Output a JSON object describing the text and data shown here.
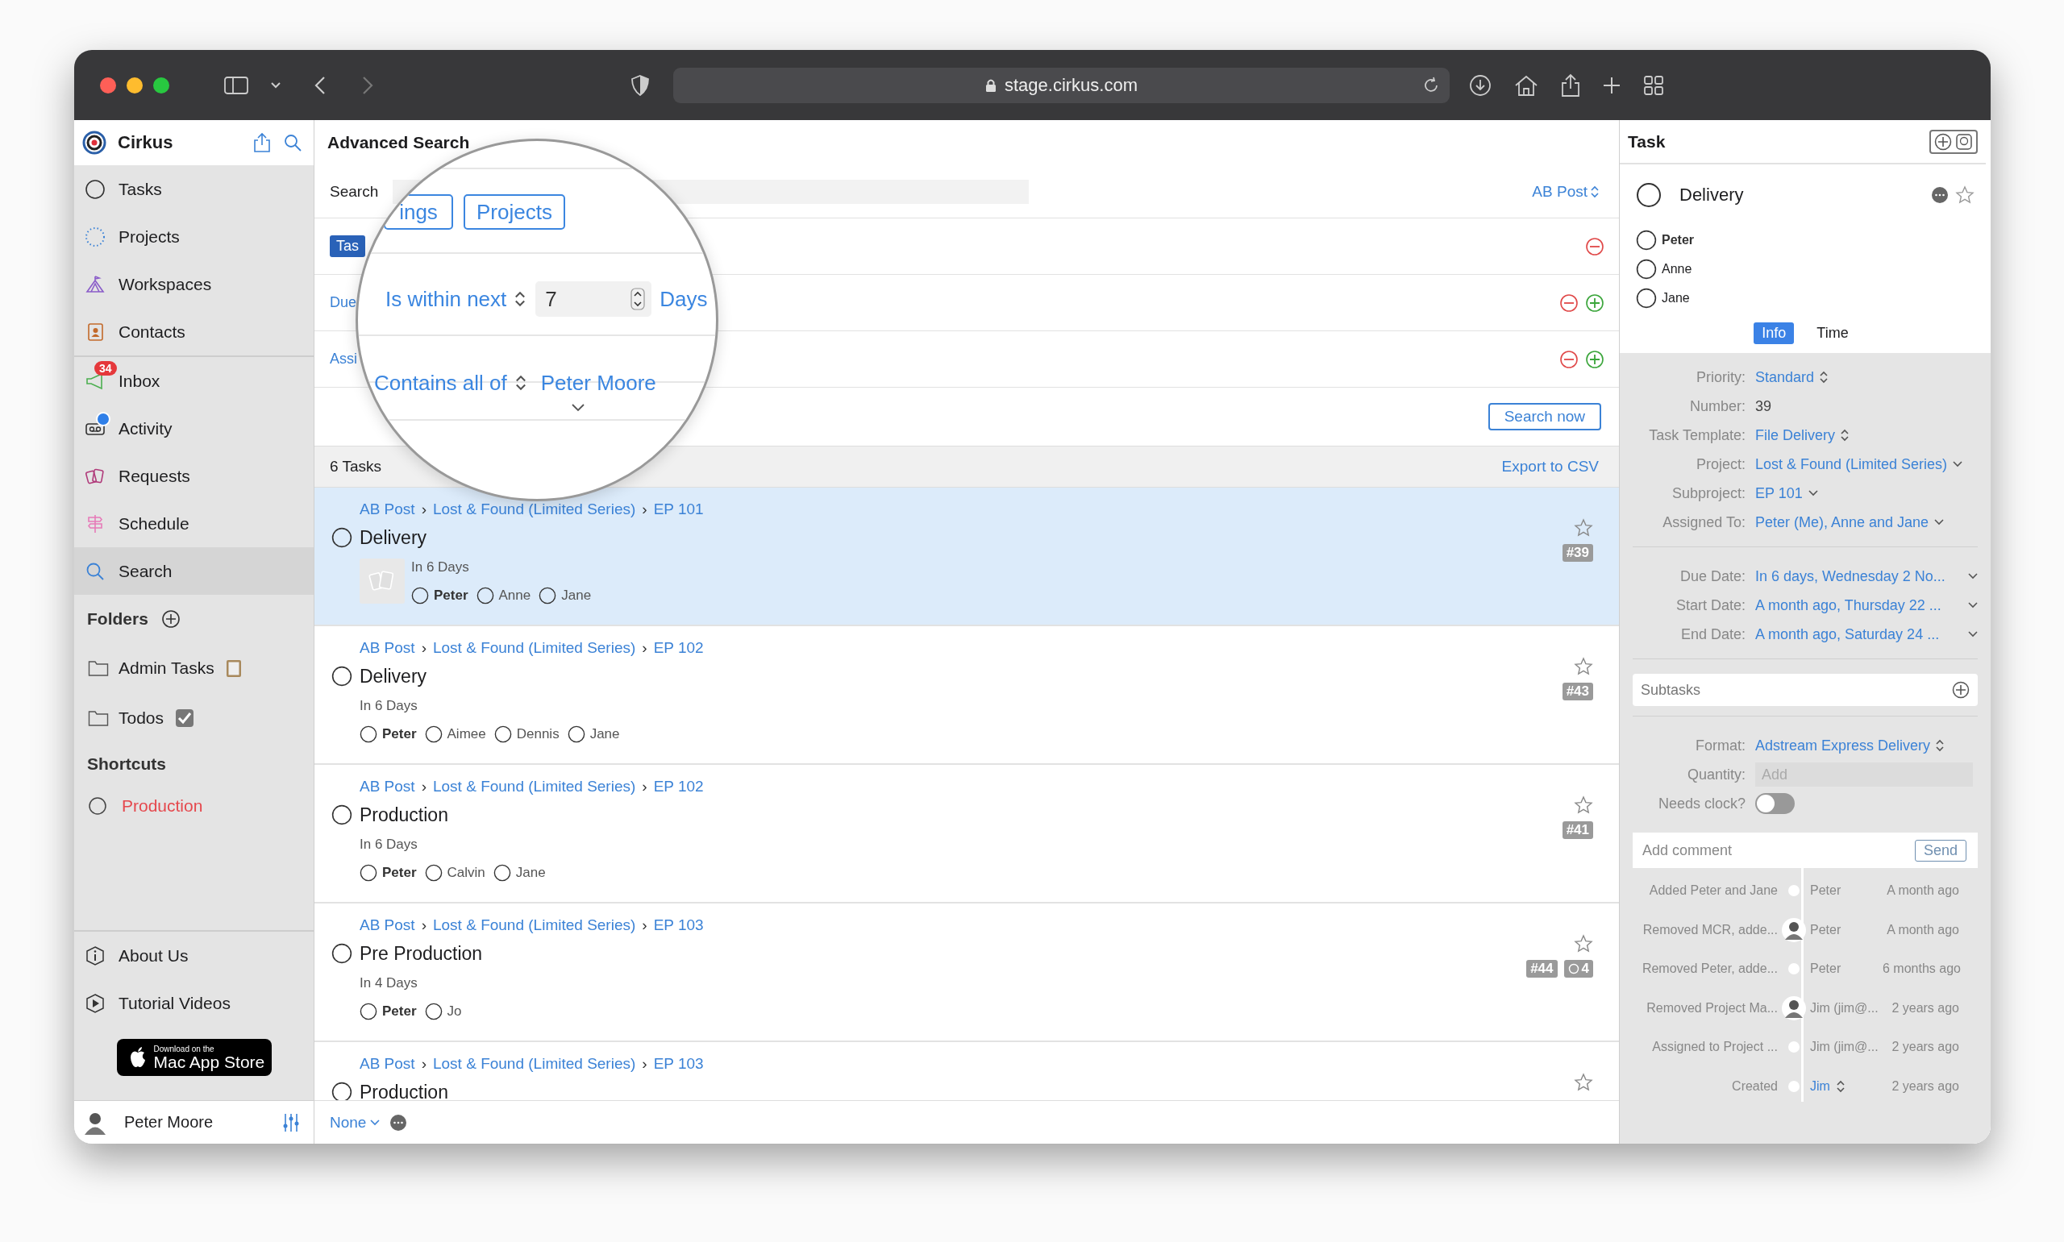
{
  "browser": {
    "url": "stage.cirkus.com"
  },
  "sidebar": {
    "app_name": "Cirkus",
    "nav_top": [
      {
        "label": "Tasks",
        "kind": "tasks",
        "selected": false
      },
      {
        "label": "Projects",
        "kind": "projects",
        "selected": false
      },
      {
        "label": "Workspaces",
        "kind": "workspaces",
        "selected": false
      },
      {
        "label": "Contacts",
        "kind": "contacts",
        "selected": false
      }
    ],
    "nav_bottom": [
      {
        "label": "Inbox",
        "kind": "inbox",
        "selected": false,
        "badge": "34"
      },
      {
        "label": "Activity",
        "kind": "activity",
        "selected": false,
        "unread": true
      },
      {
        "label": "Requests",
        "kind": "requests",
        "selected": false
      },
      {
        "label": "Schedule",
        "kind": "schedule",
        "selected": false
      },
      {
        "label": "Search",
        "kind": "search",
        "selected": true
      }
    ],
    "folders_title": "Folders",
    "folders": [
      {
        "label": "Admin Tasks",
        "kind": "notes"
      },
      {
        "label": "Todos",
        "kind": "checklist"
      }
    ],
    "shortcuts_title": "Shortcuts",
    "shortcuts": [
      {
        "label": "Production"
      }
    ],
    "footer_links": [
      {
        "label": "About Us",
        "kind": "info"
      },
      {
        "label": "Tutorial Videos",
        "kind": "video"
      }
    ],
    "store_badge": {
      "line1": "Download on the",
      "line2": "Mac App Store"
    },
    "user": {
      "name": "Peter Moore"
    }
  },
  "search": {
    "title": "Advanced Search",
    "label": "Search",
    "scope": "AB Post",
    "type_chip": "Tas",
    "criteria": [
      {
        "label": "Due",
        "add": true
      },
      {
        "label": "Assi",
        "add": true
      }
    ],
    "search_button": "Search now",
    "magnifier": {
      "buttons": [
        "ings",
        "Projects"
      ],
      "condition_1": {
        "operator": "Is within next",
        "value": "7",
        "unit": "Days"
      },
      "condition_2": {
        "operator": "Contains all of",
        "value": "Peter Moore"
      }
    }
  },
  "results": {
    "count": "6 Tasks",
    "export": "Export to CSV",
    "separator": "›",
    "tasks": [
      {
        "path": [
          "AB Post",
          "Lost & Found (Limited Series)",
          "EP 101"
        ],
        "title": "Delivery",
        "due": "In 6 Days",
        "thumbnail": true,
        "selected": true,
        "number": "#39",
        "assignees": [
          {
            "name": "Peter",
            "me": true
          },
          {
            "name": "Anne",
            "me": false
          },
          {
            "name": "Jane",
            "me": false
          }
        ]
      },
      {
        "path": [
          "AB Post",
          "Lost & Found (Limited Series)",
          "EP 102"
        ],
        "title": "Delivery",
        "due": "In 6 Days",
        "thumbnail": false,
        "selected": false,
        "number": "#43",
        "assignees": [
          {
            "name": "Peter",
            "me": true
          },
          {
            "name": "Aimee",
            "me": false
          },
          {
            "name": "Dennis",
            "me": false
          },
          {
            "name": "Jane",
            "me": false
          }
        ]
      },
      {
        "path": [
          "AB Post",
          "Lost & Found (Limited Series)",
          "EP 102"
        ],
        "title": "Production",
        "due": "In 6 Days",
        "thumbnail": false,
        "selected": false,
        "number": "#41",
        "assignees": [
          {
            "name": "Peter",
            "me": true
          },
          {
            "name": "Calvin",
            "me": false
          },
          {
            "name": "Jane",
            "me": false
          }
        ]
      },
      {
        "path": [
          "AB Post",
          "Lost & Found (Limited Series)",
          "EP 103"
        ],
        "title": "Pre Production",
        "due": "In 4 Days",
        "thumbnail": false,
        "selected": false,
        "number": "#44",
        "subtasks": "4",
        "assignees": [
          {
            "name": "Peter",
            "me": true
          },
          {
            "name": "Jo",
            "me": false
          }
        ]
      },
      {
        "path": [
          "AB Post",
          "Lost & Found (Limited Series)",
          "EP 103"
        ],
        "title": "Production",
        "selected": false
      }
    ],
    "filter": "None"
  },
  "task_panel": {
    "title": "Task",
    "task": {
      "title": "Delivery",
      "assignees": [
        {
          "name": "Peter",
          "me": true
        },
        {
          "name": "Anne",
          "me": false
        },
        {
          "name": "Jane",
          "me": false
        }
      ]
    },
    "tabs": [
      {
        "label": "Info",
        "selected": true
      },
      {
        "label": "Time",
        "selected": false
      }
    ],
    "fields": [
      {
        "label": "Priority:",
        "value": "Standard",
        "kind": "select"
      },
      {
        "label": "Number:",
        "value": "39",
        "kind": "text"
      },
      {
        "label": "Task Template:",
        "value": "File Delivery",
        "kind": "select"
      },
      {
        "label": "Project:",
        "value": "Lost & Found (Limited Series)",
        "kind": "dropdown"
      },
      {
        "label": "Subproject:",
        "value": "EP 101",
        "kind": "dropdown"
      },
      {
        "label": "Assigned To:",
        "value": "Peter (Me), Anne and Jane",
        "kind": "dropdown"
      }
    ],
    "dates": [
      {
        "label": "Due Date:",
        "value": "In 6 days, Wednesday 2 No..."
      },
      {
        "label": "Start Date:",
        "value": "A month ago, Thursday 22 ..."
      },
      {
        "label": "End Date:",
        "value": "A month ago, Saturday 24 ..."
      }
    ],
    "subtasks_label": "Subtasks",
    "extra_fields": [
      {
        "label": "Format:",
        "value": "Adstream Express Delivery",
        "kind": "select"
      },
      {
        "label": "Quantity:",
        "placeholder": "Add",
        "kind": "input"
      },
      {
        "label": "Needs clock?",
        "on": false,
        "kind": "toggle"
      }
    ],
    "comment": {
      "placeholder": "Add comment",
      "button": "Send"
    },
    "history": [
      {
        "action": "Added Peter and Jane",
        "user": "Peter",
        "time": "A month ago",
        "avatar": false,
        "kind": "text"
      },
      {
        "action": "Removed MCR, adde...",
        "user": "Peter",
        "time": "A month ago",
        "avatar": true,
        "kind": "text"
      },
      {
        "action": "Removed Peter, adde...",
        "user": "Peter",
        "time": "6 months ago",
        "avatar": false,
        "kind": "text"
      },
      {
        "action": "Removed Project Ma...",
        "user": "Jim (jim@...",
        "time": "2 years ago",
        "avatar": true,
        "kind": "text"
      },
      {
        "action": "Assigned to Project ...",
        "user": "Jim (jim@...",
        "time": "2 years ago",
        "avatar": false,
        "kind": "text"
      },
      {
        "action": "Created",
        "user": "Jim",
        "time": "2 years ago",
        "avatar": false,
        "kind": "select"
      }
    ]
  }
}
